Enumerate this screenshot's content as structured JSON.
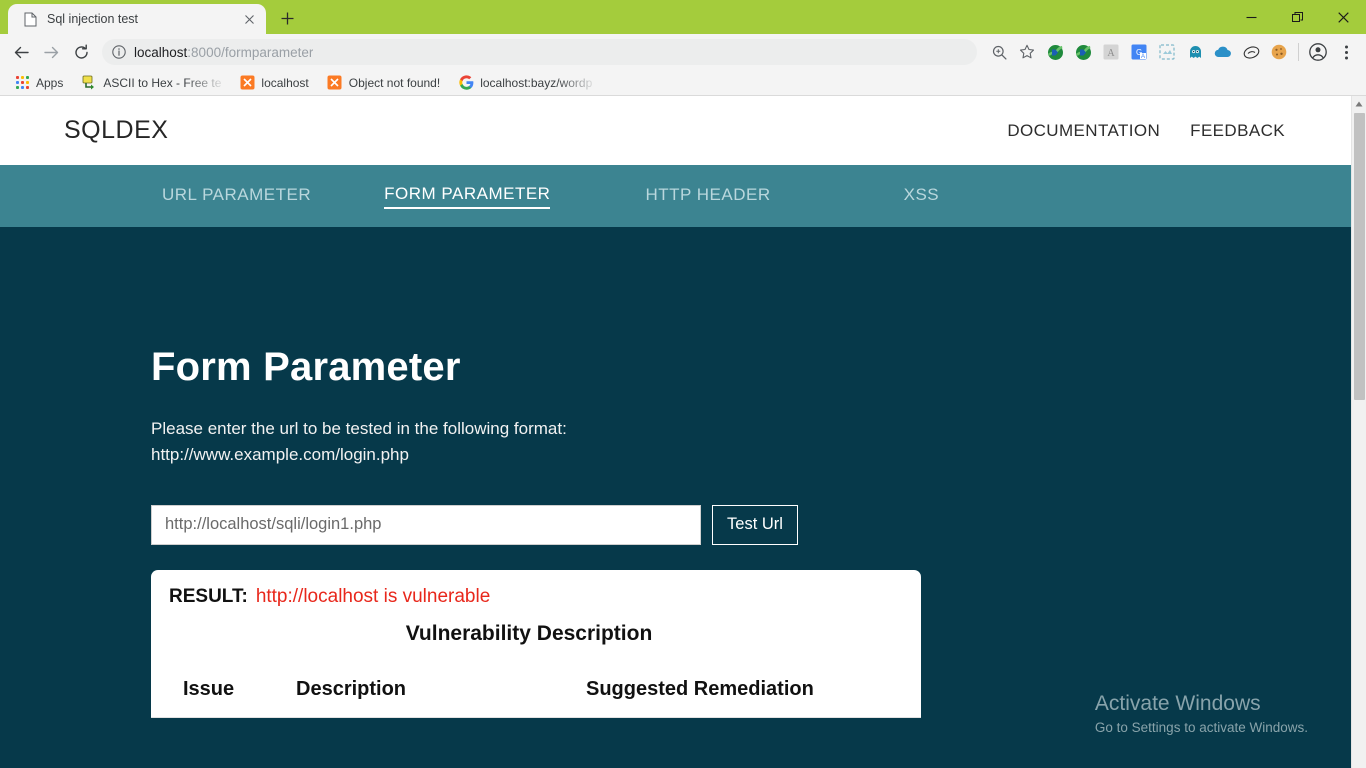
{
  "browser": {
    "tab": {
      "title": "Sql injection test",
      "favicon_icon": "page-icon",
      "close_icon": "close-icon"
    },
    "new_tab_label": "+",
    "window_controls": {
      "minimize": "—",
      "restore": "❐",
      "close": "✕"
    },
    "nav": {
      "back_icon": "arrow-back-icon",
      "forward_icon": "arrow-forward-icon",
      "reload_icon": "reload-icon"
    },
    "omnibox": {
      "info_icon": "info-circle-icon",
      "url_host": "localhost",
      "url_rest": ":8000/formparameter",
      "full_url": "localhost:8000/formparameter",
      "zoom_icon": "zoom-in-icon",
      "bookmark_icon": "star-icon"
    },
    "extensions": [
      {
        "name": "idm-extension-icon"
      },
      {
        "name": "idm-extension-icon-2"
      },
      {
        "name": "adobe-acrobat-icon"
      },
      {
        "name": "google-translate-icon"
      },
      {
        "name": "screenshot-extension-icon"
      },
      {
        "name": "ghost-extension-icon"
      },
      {
        "name": "cloud-extension-icon"
      },
      {
        "name": "tag-extension-icon"
      },
      {
        "name": "cookie-extension-icon"
      }
    ],
    "profile_icon": "account-circle-icon",
    "menu_icon": "three-dot-menu-icon",
    "bookmarks": [
      {
        "label": "Apps",
        "icon": "apps-grid-icon"
      },
      {
        "label": "ASCII to Hex - Free te",
        "icon": "ascii-tool-icon"
      },
      {
        "label": "localhost",
        "icon": "xampp-icon"
      },
      {
        "label": "Object not found!",
        "icon": "xampp-icon"
      },
      {
        "label": "localhost:bayz/wordp",
        "icon": "google-icon"
      }
    ]
  },
  "site": {
    "brand": "SQLDEX",
    "header_links": [
      {
        "label": "DOCUMENTATION"
      },
      {
        "label": "FEEDBACK"
      }
    ],
    "tabs": [
      {
        "label": "URL PARAMETER",
        "active": false
      },
      {
        "label": "FORM PARAMETER",
        "active": true
      },
      {
        "label": "HTTP HEADER",
        "active": false
      },
      {
        "label": "XSS",
        "active": false
      }
    ],
    "main": {
      "title": "Form Parameter",
      "description_line1": "Please enter the url to be tested in the following format:",
      "description_line2": "http://www.example.com/login.php",
      "url_input_placeholder": "http://localhost/sqli/login1.php",
      "url_input_value": "",
      "test_button_label": "Test Url"
    },
    "result": {
      "label": "RESULT:",
      "value": "http://localhost is vulnerable",
      "value_color": "#e8271b",
      "section_title": "Vulnerability Description",
      "table": {
        "headers": [
          "Issue",
          "Description",
          "Suggested Remediation"
        ],
        "rows": []
      }
    }
  },
  "watermark": {
    "title": "Activate Windows",
    "subtitle": "Go to Settings to activate Windows."
  },
  "colors": {
    "titlebar_green": "#a4cc3c",
    "page_dark_teal": "#06394a",
    "tabs_bar_teal": "#3c8491",
    "accent_red": "#e8271b",
    "white": "#ffffff"
  }
}
